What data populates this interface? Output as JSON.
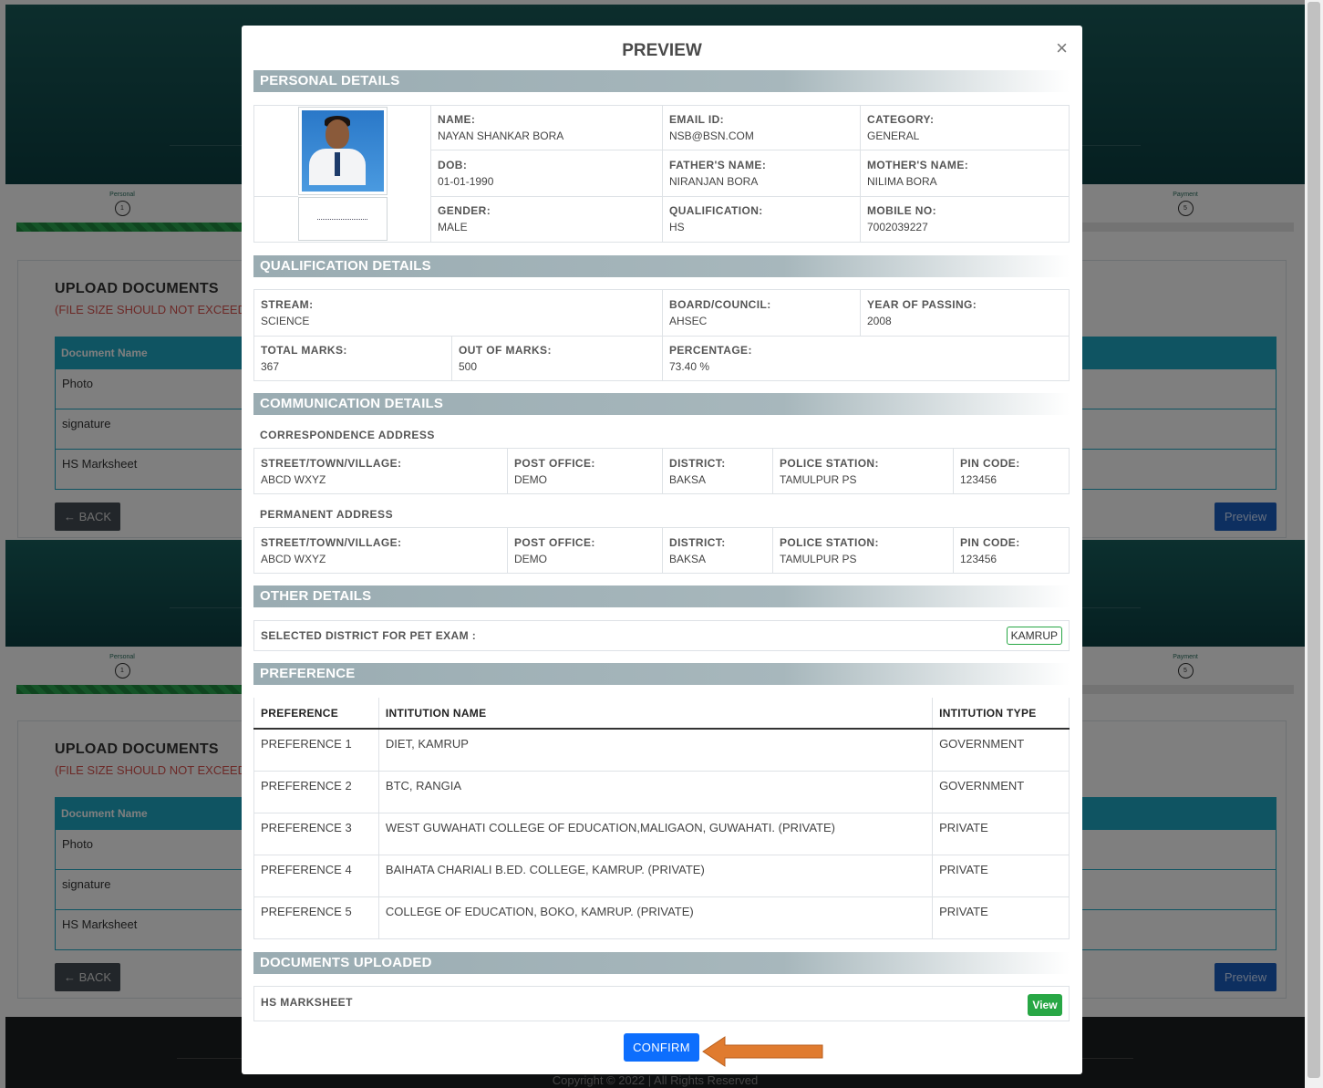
{
  "background": {
    "steps": {
      "first_label": "Personal",
      "first_num": "1",
      "last_label": "Payment",
      "last_num": "5"
    },
    "upload": {
      "title": "UPLOAD DOCUMENTS",
      "warning": "(FILE SIZE SHOULD NOT EXCEED",
      "col_header": "Document Name",
      "rows": [
        "Photo",
        "signature",
        "HS Marksheet"
      ],
      "back_label": "← BACK",
      "preview_label": "Preview"
    },
    "footer": {
      "copyright": "Copyright © 2022 | All Rights Reserved"
    }
  },
  "modal": {
    "title": "PREVIEW",
    "close": "×",
    "personal": {
      "heading": "PERSONAL DETAILS",
      "name_label": "NAME:",
      "name": "NAYAN SHANKAR BORA",
      "email_label": "EMAIL ID:",
      "email": "NSB@BSN.COM",
      "category_label": "CATEGORY:",
      "category": "GENERAL",
      "dob_label": "DOB:",
      "dob": "01-01-1990",
      "father_label": "FATHER'S NAME:",
      "father": "NIRANJAN BORA",
      "mother_label": "MOTHER'S NAME:",
      "mother": "NILIMA BORA",
      "gender_label": "GENDER:",
      "gender": "MALE",
      "qualification_label": "QUALIFICATION:",
      "qualification": "HS",
      "mobile_label": "MOBILE NO:",
      "mobile": "7002039227"
    },
    "qualification": {
      "heading": "QUALIFICATION DETAILS",
      "stream_label": "STREAM:",
      "stream": "SCIENCE",
      "board_label": "BOARD/COUNCIL:",
      "board": "AHSEC",
      "year_label": "YEAR OF PASSING:",
      "year": "2008",
      "total_label": "TOTAL MARKS:",
      "total": "367",
      "outof_label": "OUT OF MARKS:",
      "outof": "500",
      "percentage_label": "PERCENTAGE:",
      "percentage": "73.40 %"
    },
    "communication": {
      "heading": "COMMUNICATION DETAILS",
      "correspondence_label": "CORRESPONDENCE ADDRESS",
      "permanent_label": "PERMANENT ADDRESS",
      "street_label": "STREET/TOWN/VILLAGE:",
      "po_label": "POST OFFICE:",
      "district_label": "DISTRICT:",
      "ps_label": "POLICE STATION:",
      "pin_label": "PIN CODE:",
      "correspondence": {
        "street": "ABCD WXYZ",
        "po": "DEMO",
        "district": "BAKSA",
        "ps": "TAMULPUR PS",
        "pin": "123456"
      },
      "permanent": {
        "street": "ABCD WXYZ",
        "po": "DEMO",
        "district": "BAKSA",
        "ps": "TAMULPUR PS",
        "pin": "123456"
      }
    },
    "other": {
      "heading": "OTHER DETAILS",
      "district_label": "SELECTED DISTRICT FOR PET EXAM :",
      "district": "KAMRUP"
    },
    "preference": {
      "heading": "PREFERENCE",
      "col_pref": "PREFERENCE",
      "col_name": "INTITUTION NAME",
      "col_type": "INTITUTION TYPE",
      "rows": [
        {
          "pref": "PREFERENCE 1",
          "name": "DIET, KAMRUP",
          "type": "GOVERNMENT"
        },
        {
          "pref": "PREFERENCE 2",
          "name": "BTC, RANGIA",
          "type": "GOVERNMENT"
        },
        {
          "pref": "PREFERENCE 3",
          "name": "WEST GUWAHATI COLLEGE OF EDUCATION,MALIGAON, GUWAHATI. (PRIVATE)",
          "type": "PRIVATE"
        },
        {
          "pref": "PREFERENCE 4",
          "name": "BAIHATA CHARIALI B.ED. COLLEGE, KAMRUP. (PRIVATE)",
          "type": "PRIVATE"
        },
        {
          "pref": "PREFERENCE 5",
          "name": "COLLEGE OF EDUCATION, BOKO, KAMRUP. (PRIVATE)",
          "type": "PRIVATE"
        }
      ]
    },
    "documents": {
      "heading": "DOCUMENTS UPLOADED",
      "doc_name": "HS MARKSHEET",
      "view_label": "View"
    },
    "confirm_label": "CONFIRM"
  },
  "colors": {
    "accent_arrow": "#e07b2f",
    "confirm_blue": "#0d6efd",
    "view_green": "#28a745"
  }
}
